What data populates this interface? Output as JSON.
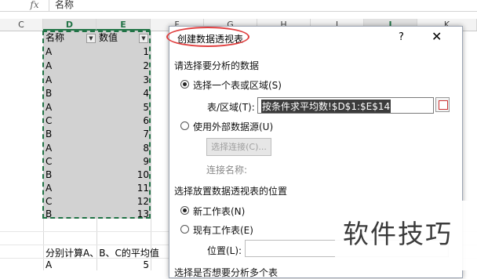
{
  "formula_bar": {
    "fx_label": "fx",
    "content": "名称"
  },
  "columns": [
    "C",
    "D",
    "E",
    "F",
    "G",
    "H",
    "I",
    "J",
    "K"
  ],
  "table": {
    "header_name": "名称",
    "header_value": "数值",
    "rows": [
      {
        "name": "A",
        "value": "1"
      },
      {
        "name": "A",
        "value": "2"
      },
      {
        "name": "A",
        "value": "3"
      },
      {
        "name": "B",
        "value": "4"
      },
      {
        "name": "A",
        "value": "5"
      },
      {
        "name": "C",
        "value": "6"
      },
      {
        "name": "B",
        "value": "7"
      },
      {
        "name": "A",
        "value": "8"
      },
      {
        "name": "C",
        "value": "9"
      },
      {
        "name": "B",
        "value": "10"
      },
      {
        "name": "A",
        "value": "11"
      },
      {
        "name": "C",
        "value": "12"
      },
      {
        "name": "B",
        "value": "13"
      }
    ]
  },
  "note_text": "分别计算A、B、C的平均值",
  "result_row": {
    "name": "A",
    "value": "5"
  },
  "dialog": {
    "title": "创建数据透视表",
    "help": "?",
    "close": "✕",
    "section1": "请选择要分析的数据",
    "option_table": "选择一个表或区域(S)",
    "range_label": "表/区域(T):",
    "range_value": "按条件求平均数!$D$1:$E$14",
    "option_external": "使用外部数据源(U)",
    "choose_conn_button": "选择连接(C)...",
    "conn_name_label": "连接名称:",
    "section2": "选择放置数据透视表的位置",
    "option_new_sheet": "新工作表(N)",
    "option_existing_sheet": "现有工作表(E)",
    "location_label": "位置(L):",
    "section3": "选择是否想要分析多个表"
  },
  "watermark": "软件技巧"
}
